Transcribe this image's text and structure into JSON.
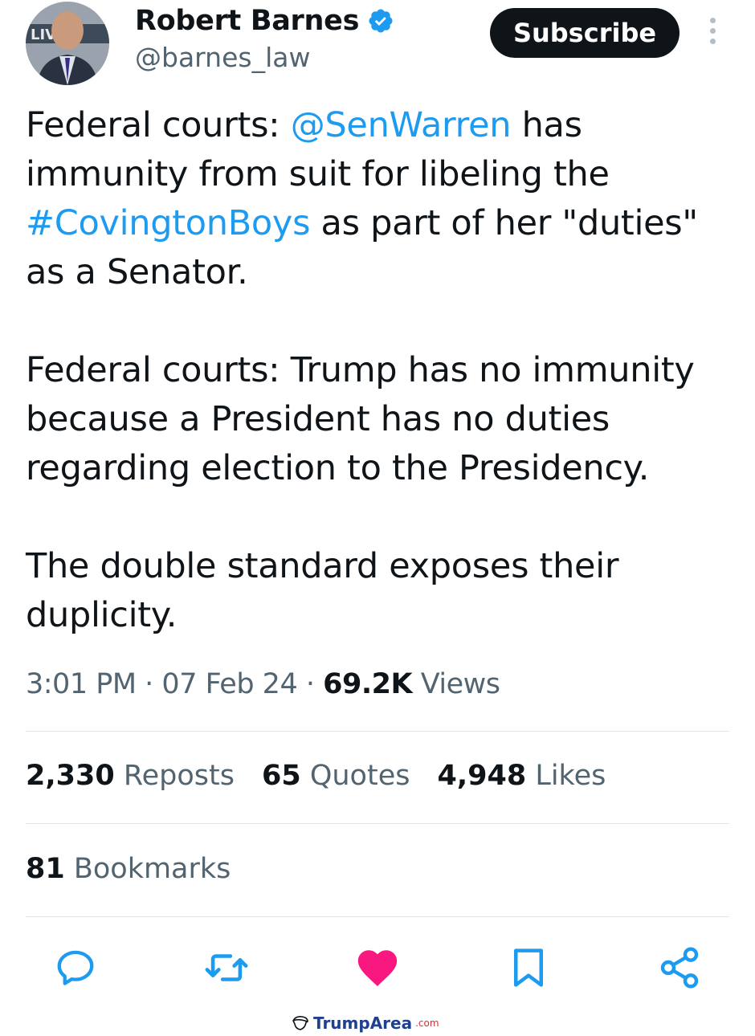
{
  "author": {
    "display_name": "Robert Barnes",
    "handle": "@barnes_law",
    "avatar_text": "LIVE"
  },
  "header": {
    "subscribe_label": "Subscribe"
  },
  "tweet": {
    "p1_pre": "Federal courts: ",
    "p1_mention": "@SenWarren",
    "p1_mid": " has immunity from suit for libeling the ",
    "p1_hashtag": "#CovingtonBoys",
    "p1_post": " as part of her \"duties\" as a Senator.",
    "p2": "Federal courts: Trump has no immunity because a President has no duties regarding election to the Presidency.",
    "p3": "The double standard exposes their duplicity."
  },
  "meta": {
    "time": "3:01 PM",
    "sep": " · ",
    "date": "07 Feb 24",
    "views_count": "69.2K",
    "views_label": " Views"
  },
  "stats": {
    "reposts_count": "2,330",
    "reposts_label": "Reposts",
    "quotes_count": "65",
    "quotes_label": "Quotes",
    "likes_count": "4,948",
    "likes_label": "Likes",
    "bookmarks_count": "81",
    "bookmarks_label": "Bookmarks"
  },
  "actions": {
    "reply_icon": "speech-bubble-icon",
    "repost_icon": "repost-arrows-icon",
    "like_icon": "heart-icon",
    "bookmark_icon": "bookmark-icon",
    "share_icon": "share-icon"
  },
  "watermark": {
    "brand": "TrumpArea",
    "suffix": ".com"
  },
  "colors": {
    "link": "#1d9bf0",
    "like": "#f91880",
    "muted": "#536471",
    "text": "#0f1419",
    "verified": "#1d9bf0"
  }
}
